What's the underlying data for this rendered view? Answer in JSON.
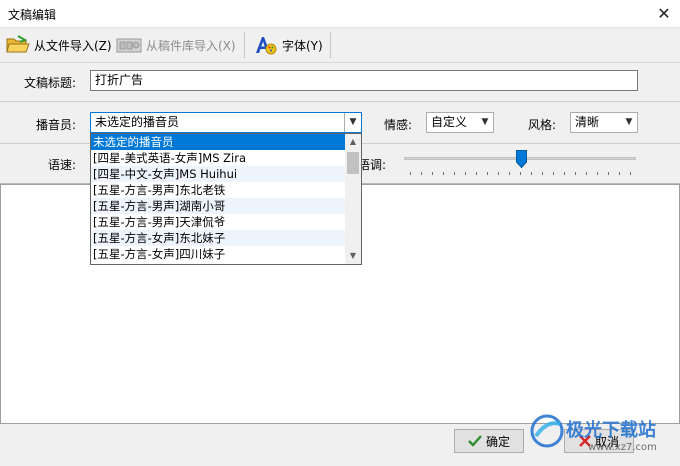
{
  "window": {
    "title": "文稿编辑",
    "close_symbol": "✕"
  },
  "toolbar": {
    "import_file": {
      "label": "从文件导入(Z)",
      "icon": "folder-open-icon"
    },
    "import_library": {
      "label": "从稿件库导入(X)",
      "icon": "library-icon",
      "disabled": true
    },
    "font": {
      "label": "字体(Y)",
      "icon": "font-icon"
    }
  },
  "form": {
    "title_label": "文稿标题:",
    "title_value": "打折广告",
    "announcer_label": "播音员:",
    "announcer_value": "未选定的播音员",
    "emotion_label": "情感:",
    "emotion_value": "自定义",
    "style_label": "风格:",
    "style_value": "清晰",
    "speed_label": "语速:",
    "pitch_label": "语调:"
  },
  "announcer_dropdown": {
    "options": [
      "未选定的播音员",
      "[四星-美式英语-女声]MS Zira",
      "[四星-中文-女声]MS Huihui",
      "[五星-方言-男声]东北老铁",
      "[五星-方言-男声]湖南小哥",
      "[五星-方言-男声]天津侃爷",
      "[五星-方言-女声]东北妹子",
      "[五星-方言-女声]四川妹子"
    ],
    "selected_index": 0
  },
  "buttons": {
    "ok": "确定",
    "cancel": "取消"
  },
  "watermark": {
    "text": "极光下载站",
    "url": "www.xz7.com"
  },
  "colors": {
    "selection": "#0078d7",
    "ok_check": "#2e8b2e",
    "cancel_x": "#d62828",
    "watermark_blue": "#1e6fd0"
  }
}
